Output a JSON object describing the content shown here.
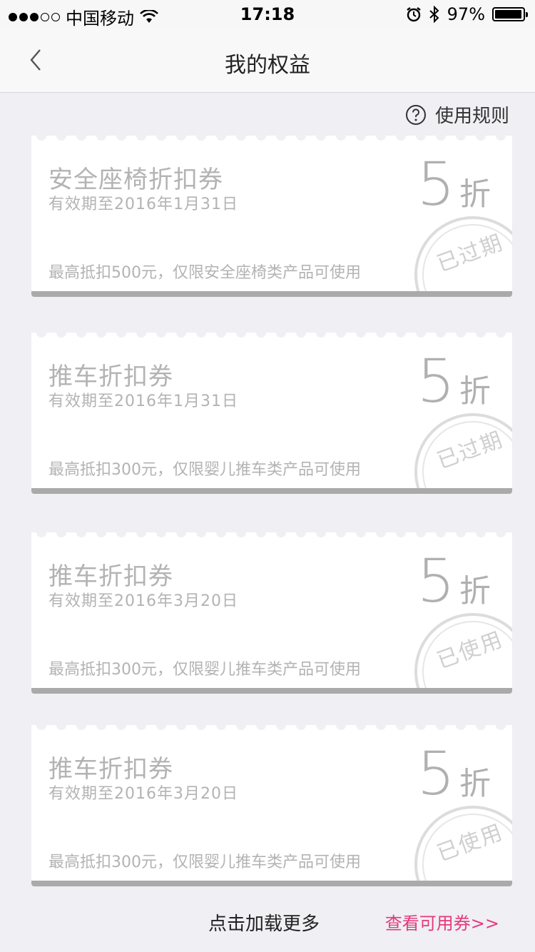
{
  "status": {
    "carrier": "中国移动",
    "time": "17:18",
    "battery": "97%",
    "battery_level": 0.97
  },
  "nav": {
    "title": "我的权益"
  },
  "rules_label": "使用规则",
  "coupons": [
    {
      "title": "安全座椅折扣券",
      "valid": "有效期至2016年1月31日",
      "limit": "最高抵扣500元，仅限安全座椅类产品可使用",
      "discount": "5",
      "unit": "折",
      "stamp": "已过期"
    },
    {
      "title": "推车折扣券",
      "valid": "有效期至2016年1月31日",
      "limit": "最高抵扣300元，仅限婴儿推车类产品可使用",
      "discount": "5",
      "unit": "折",
      "stamp": "已过期"
    },
    {
      "title": "推车折扣券",
      "valid": "有效期至2016年3月20日",
      "limit": "最高抵扣300元，仅限婴儿推车类产品可使用",
      "discount": "5",
      "unit": "折",
      "stamp": "已使用"
    },
    {
      "title": "推车折扣券",
      "valid": "有效期至2016年3月20日",
      "limit": "最高抵扣300元，仅限婴儿推车类产品可使用",
      "discount": "5",
      "unit": "折",
      "stamp": "已使用"
    }
  ],
  "footer": {
    "load_more": "点击加载更多",
    "view_usable": "查看可用券>>"
  },
  "colors": {
    "accent": "#e4397d",
    "muted_text": "#b3b3b3",
    "background": "#efeff4"
  },
  "icons": {
    "back": "chevron-left-icon",
    "rules": "question-circle-icon",
    "wifi": "wifi-icon",
    "alarm": "alarm-icon",
    "bluetooth": "bluetooth-icon",
    "battery": "battery-icon"
  }
}
